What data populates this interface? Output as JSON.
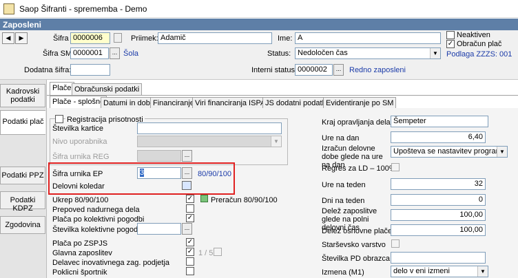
{
  "window": {
    "title": "Saop Šifranti - sprememba - Demo"
  },
  "section": {
    "title": "Zaposleni"
  },
  "nav": {
    "prev": "◀",
    "next": "▶"
  },
  "header": {
    "sifra_label": "Šifra",
    "sifra_value": "0000006",
    "priimek_label": "Priimek:",
    "priimek_value": "Adamič",
    "ime_label": "Ime:",
    "ime_value": "A",
    "neaktiven_label": "Neaktiven",
    "neaktiven_checked": "",
    "obracun_label": "Obračun plač",
    "obracun_checked": "✓",
    "sifra_sm_label": "Šifra SM",
    "sifra_sm_value": "0000001",
    "sifra_sm_link": "Šola",
    "status_label": "Status:",
    "status_value": "Nedoločen čas",
    "podlaga_link": "Podlaga ZZZS: 001",
    "dodatna_label": "Dodatna šifra:",
    "dodatna_value": "",
    "interni_label": "Interni statusi:",
    "interni_value": "0000002",
    "interni_link": "Redno zaposleni",
    "ellipsis": "..."
  },
  "sidebar": {
    "items": [
      {
        "label": "Kadrovski podatki"
      },
      {
        "label": "Podatki plač"
      },
      {
        "label": "Podatki PPZ"
      },
      {
        "label": "Podatki KDPZ"
      },
      {
        "label": "Zgodovina"
      }
    ]
  },
  "tabs_top": [
    {
      "label": "Plače"
    },
    {
      "label": "Obračunski podatki"
    }
  ],
  "tabs_sub": [
    {
      "label": "Plače - splošno"
    },
    {
      "label": "Datumi in dobe"
    },
    {
      "label": "Financiranje"
    },
    {
      "label": "Viri financiranja ISPAP"
    },
    {
      "label": "JS dodatni podatki"
    },
    {
      "label": "Evidentiranje po SM"
    }
  ],
  "left": {
    "registracija_label": "Registracija prisotnosti",
    "stevilka_kartice_label": "Številka kartice",
    "stevilka_kartice_value": "",
    "nivo_label": "Nivo uporabnika",
    "nivo_value": "",
    "sifra_reg_label": "Šifra urnika REG",
    "sifra_reg_value": "",
    "sifra_ep_label": "Šifra urnika EP",
    "sifra_ep_value": "3",
    "sifra_ep_link": "80/90/100",
    "delovni_koledar_label": "Delovni koledar",
    "ukrep_label": "Ukrep 80/90/100",
    "preracun_label": "Preračun 80/90/100",
    "prepoved_label": "Prepoved nadurnega dela",
    "placa_kp_label": "Plača po kolektivni pogodbi",
    "stevilka_kp_label": "Številka kolektivne pogodbe",
    "stevilka_kp_value": "",
    "placa_zspjs_label": "Plača po ZSPJS",
    "glavna_label": "Glavna zaposlitev",
    "glavna_ratio": "1 / 5",
    "delavec_label": "Delavec inovativnega zag. podjetja",
    "poklicni_label": "Poklicni športnik"
  },
  "right": {
    "kraj_label": "Kraj opravljanja dela",
    "kraj_value": "Šempeter",
    "ure_dan_label": "Ure na dan",
    "ure_dan_value": "6,40",
    "izracun_label": "Izračun delovne dobe glede na ure na dan",
    "izracun_value": "Upošteva se nastavitev programa",
    "regres_label": "Regres za LD – 100%",
    "ure_teden_label": "Ure na teden",
    "ure_teden_value": "32",
    "dni_teden_label": "Dni na teden",
    "dni_teden_value": "0",
    "delez_zap_label": "Delež zaposlitve glede na polni delovni čas",
    "delez_zap_value": "100,00",
    "delez_osn_label": "Delež osnovne plače",
    "delez_osn_value": "100,00",
    "starsevsko_label": "Starševsko varstvo",
    "stevilka_pd_label": "Številka PD obrazca",
    "stevilka_pd_value": "",
    "izmena_label": "Izmena (M1)",
    "izmena_value": "delo v eni izmeni"
  }
}
